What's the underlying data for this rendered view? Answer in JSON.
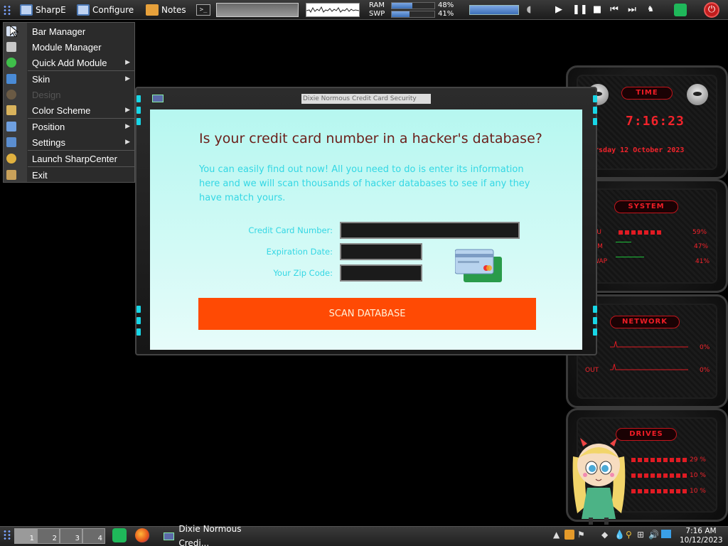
{
  "topbar": {
    "launcher_label": "SharpE",
    "configure_label": "Configure",
    "notes_label": "Notes",
    "terminal_glyph": ">_",
    "ram_label": "RAM",
    "swp_label": "SWP",
    "ram_pct": "48%",
    "swp_pct": "41%",
    "ram_fraction": 0.48,
    "swp_fraction": 0.41
  },
  "menu": {
    "items": [
      {
        "label": "Bar Manager",
        "icon": "bar-manager-icon",
        "submenu": false,
        "disabled": false
      },
      {
        "label": "Module Manager",
        "icon": "cube-icon",
        "submenu": false,
        "disabled": false
      },
      {
        "label": "Quick Add Module",
        "icon": "plus-circle-icon",
        "submenu": true,
        "disabled": false
      },
      {
        "label": "Skin",
        "icon": "paint-bucket-icon",
        "submenu": true,
        "disabled": false
      },
      {
        "label": "Design",
        "icon": "palette-icon",
        "submenu": false,
        "disabled": true
      },
      {
        "label": "Color Scheme",
        "icon": "brush-icon",
        "submenu": true,
        "disabled": false
      },
      {
        "label": "Position",
        "icon": "position-icon",
        "submenu": true,
        "disabled": false
      },
      {
        "label": "Settings",
        "icon": "wrench-icon",
        "submenu": true,
        "disabled": false
      },
      {
        "label": "Launch SharpCenter",
        "icon": "gear-icon",
        "submenu": false,
        "disabled": false
      },
      {
        "label": "Exit",
        "icon": "door-icon",
        "submenu": false,
        "disabled": false
      }
    ]
  },
  "dialog": {
    "window_title": "Dixie Normous Credit Card Security",
    "headline": "Is your credit card number in a hacker's database?",
    "intro": "You can easily find out now! All you need to do is enter its information here and we will scan thousands of hacker databases to see if any they have match yours.",
    "fields": {
      "card_number_label": "Credit Card Number:",
      "card_number_value": "",
      "expiration_label": "Expiration Date:",
      "expiration_value": "",
      "zip_label": "Your Zip Code:",
      "zip_value": ""
    },
    "button_label": "SCAN DATABASE",
    "button_color": "#ff4a04",
    "background_color": "#c9f9f3",
    "headline_color": "#6b1f1a",
    "text_color": "#34d7e4"
  },
  "widgets": {
    "time": {
      "header": "TIME",
      "clock": "7:16:23",
      "date": "ursday 12 October 2023"
    },
    "system": {
      "header": "SYSTEM",
      "rows": [
        {
          "label": "PU",
          "value": "59%"
        },
        {
          "label": "AM",
          "value": "47%"
        },
        {
          "label": "WAP",
          "value": "41%"
        }
      ]
    },
    "network": {
      "header": "NETWORK",
      "rows": [
        {
          "label": "",
          "value": "0%"
        },
        {
          "label": "OUT",
          "value": "0%"
        }
      ]
    },
    "drives": {
      "header": "DRIVES",
      "values": [
        "29 %",
        "10 %",
        "10 %"
      ]
    }
  },
  "taskbar": {
    "workspaces": [
      "1",
      "2",
      "3",
      "4"
    ],
    "window_label": "Dixie Normous Credi...",
    "time": "7:16 AM",
    "date": "10/12/2023"
  }
}
